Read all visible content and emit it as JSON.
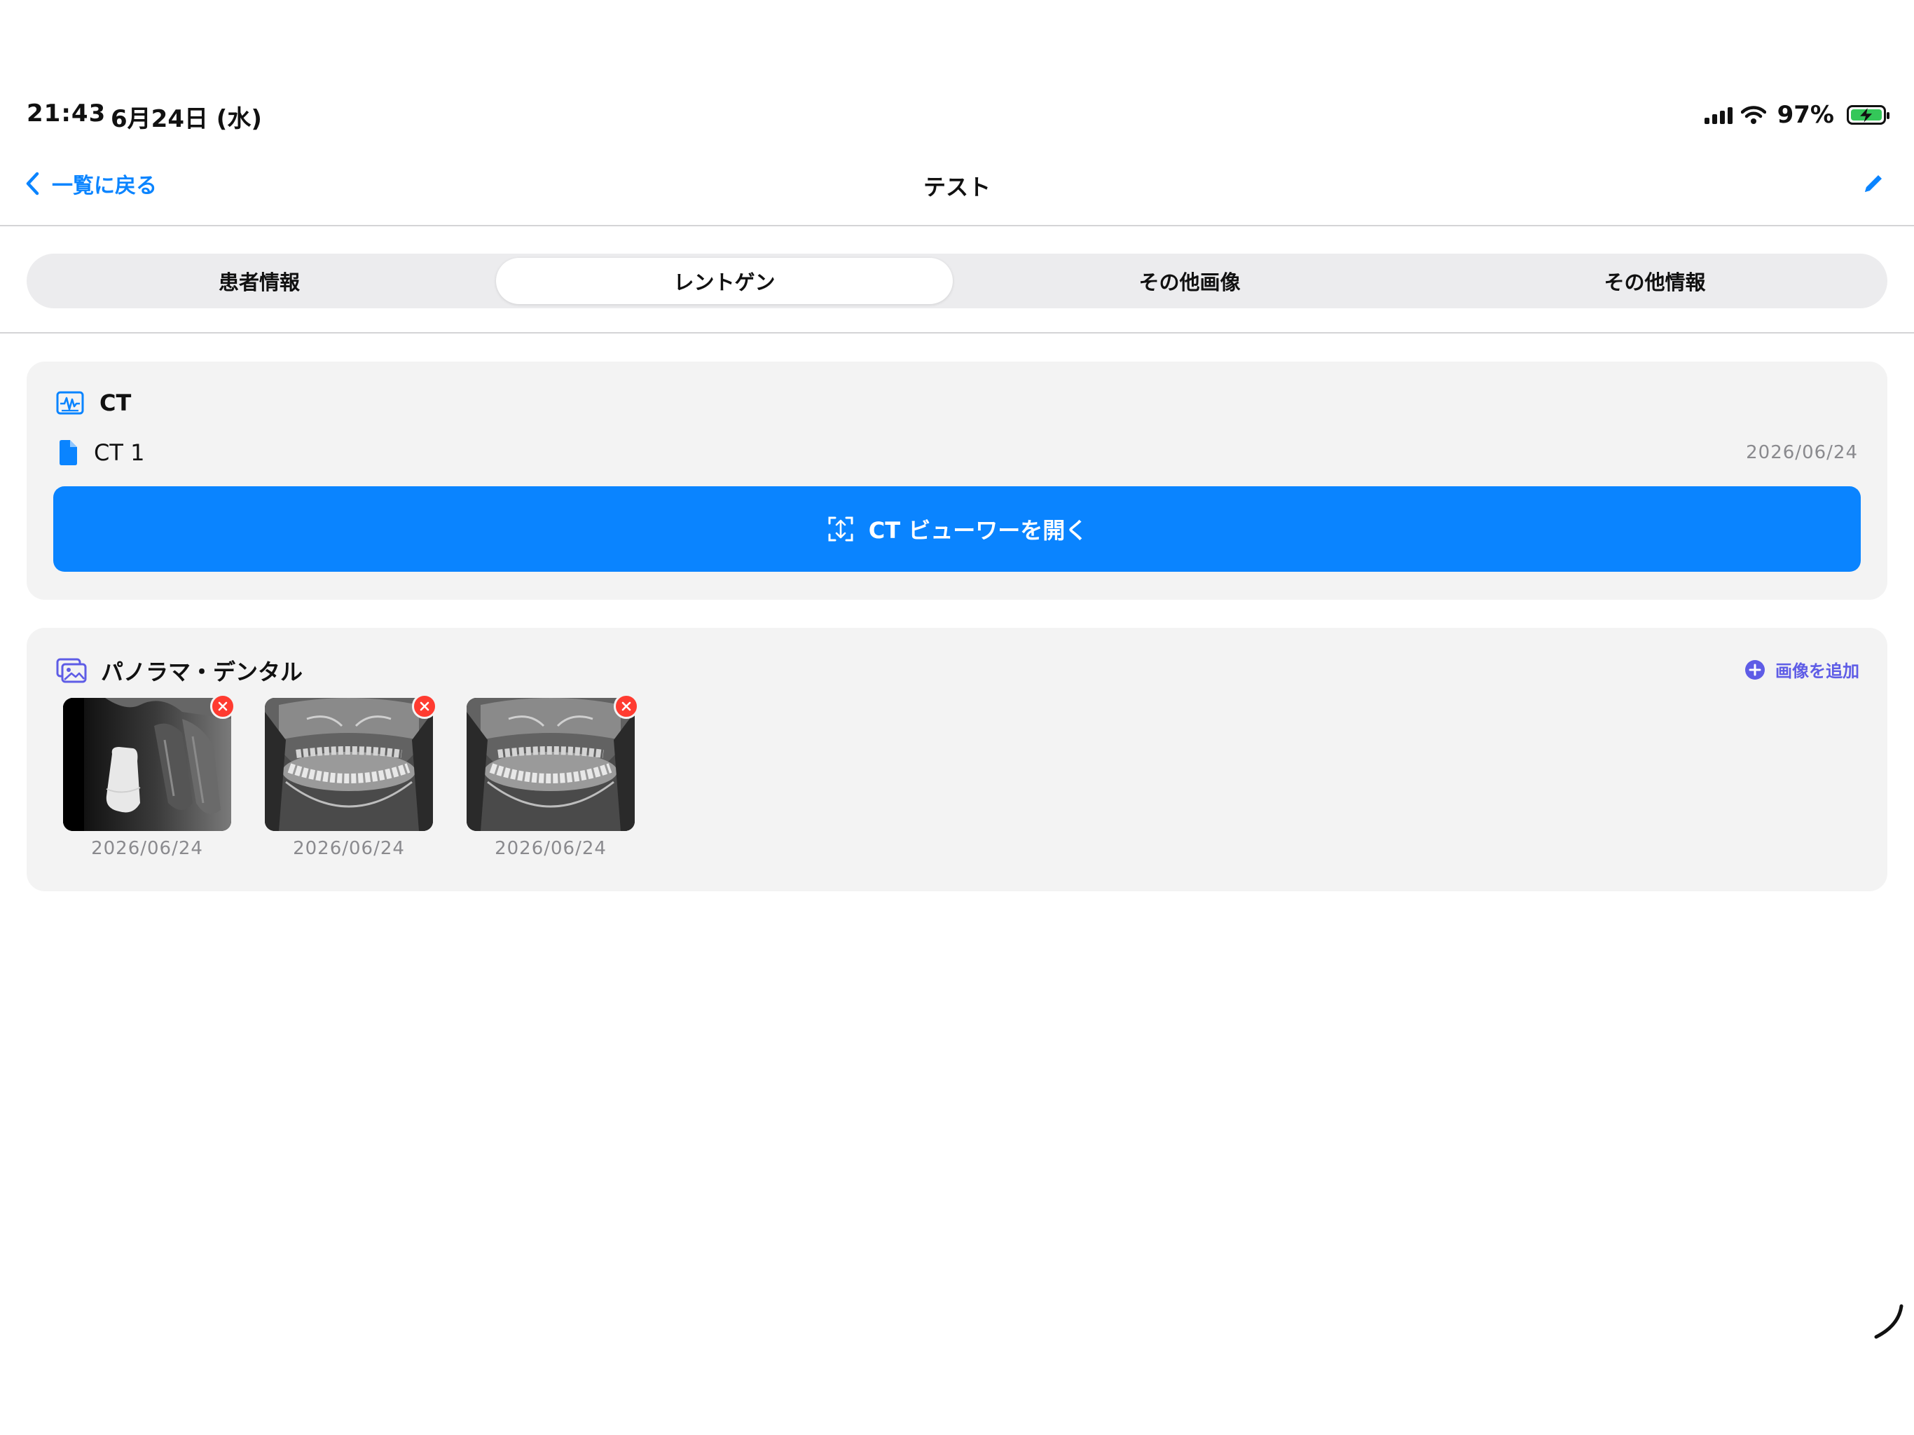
{
  "status_bar": {
    "time": "21:43",
    "date": "6月24日 (水)",
    "battery_percent": "97%",
    "battery_level": 0.97,
    "icons": [
      "cellular-signal-icon",
      "wifi-icon",
      "battery-charging-icon"
    ]
  },
  "nav": {
    "back_label": "一覧に戻る",
    "title": "テスト",
    "edit_icon": "pencil-icon"
  },
  "tabs": [
    {
      "label": "患者情報",
      "selected": false
    },
    {
      "label": "レントゲン",
      "selected": true
    },
    {
      "label": "その他画像",
      "selected": false
    },
    {
      "label": "その他情報",
      "selected": false
    }
  ],
  "ct_section": {
    "title": "CT",
    "icon": "waveform-icon",
    "file": {
      "name": "CT 1",
      "date": "2026/06/24",
      "icon": "document-icon"
    },
    "open_button_label": "CT ビューワーを開く",
    "open_button_icon": "3d-rotate-icon"
  },
  "pano_section": {
    "title": "パノラマ・デンタル",
    "icon": "photo-stack-icon",
    "add_label": "画像を追加",
    "images": [
      {
        "kind": "dental",
        "date": "2026/06/24"
      },
      {
        "kind": "panoramic",
        "date": "2026/06/24"
      },
      {
        "kind": "panoramic",
        "date": "2026/06/24"
      }
    ]
  },
  "colors": {
    "accent": "#0a84ff",
    "purple": "#5e5ce6",
    "delete": "#ff3b30",
    "card_bg": "#f3f3f3",
    "secondary_text": "#8a8a8e"
  }
}
